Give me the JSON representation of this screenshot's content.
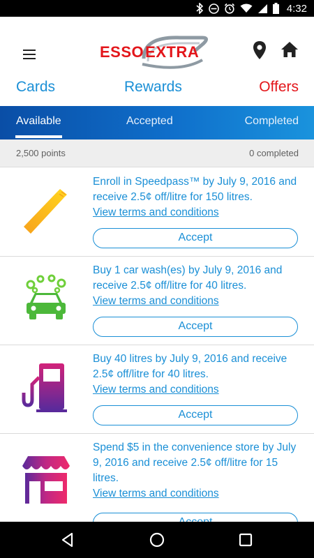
{
  "status_bar": {
    "time": "4:32",
    "icons": [
      "bluetooth-icon",
      "do-not-disturb-icon",
      "alarm-icon",
      "wifi-icon",
      "cell-signal-icon",
      "battery-icon"
    ]
  },
  "header": {
    "menu_icon": "hamburger-menu-icon",
    "logo_left": "ESSO",
    "logo_right": "EXTRA",
    "location_icon": "location-pin-icon",
    "home_icon": "home-icon",
    "tabs": [
      {
        "label": "Cards",
        "color": "#1a8fd6"
      },
      {
        "label": "Rewards",
        "color": "#1a8fd6"
      },
      {
        "label": "Offers",
        "color": "#e3161b"
      }
    ]
  },
  "sub_tabs": {
    "items": [
      {
        "label": "Available",
        "selected": true
      },
      {
        "label": "Accepted",
        "selected": false
      },
      {
        "label": "Completed",
        "selected": false
      }
    ]
  },
  "summary": {
    "points": "2,500 points",
    "completed": "0 completed"
  },
  "offers": [
    {
      "icon": "speedpass-tag-icon",
      "description": "Enroll in Speedpass™ by July 9, 2016 and receive 2.5¢ off/litre for 150 litres.",
      "link": "View terms and conditions",
      "button": "Accept"
    },
    {
      "icon": "car-wash-icon",
      "description": "Buy 1 car wash(es) by July 9, 2016 and receive 2.5¢ off/litre for 40 litres.",
      "link": "View terms and conditions",
      "button": "Accept"
    },
    {
      "icon": "fuel-pump-icon",
      "description": "Buy 40 litres by July 9, 2016 and receive 2.5¢ off/litre for 40 litres.",
      "link": "View terms and conditions",
      "button": "Accept"
    },
    {
      "icon": "convenience-store-icon",
      "description": "Spend $5 in the convenience store by July 9, 2016 and receive 2.5¢ off/litre for 15 litres.",
      "link": "View terms and conditions",
      "button": "Accept"
    }
  ],
  "colors": {
    "accent_blue": "#1a8fd6",
    "brand_red": "#e3161b"
  },
  "nav_bar": {
    "icons": [
      "back-icon",
      "home-circle-icon",
      "recents-icon"
    ]
  }
}
